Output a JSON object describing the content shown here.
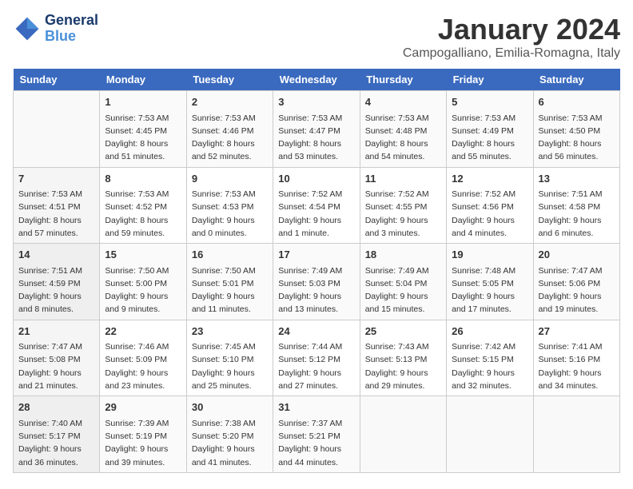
{
  "header": {
    "logo_line1": "General",
    "logo_line2": "Blue",
    "title": "January 2024",
    "subtitle": "Campogalliano, Emilia-Romagna, Italy"
  },
  "days_of_week": [
    "Sunday",
    "Monday",
    "Tuesday",
    "Wednesday",
    "Thursday",
    "Friday",
    "Saturday"
  ],
  "weeks": [
    [
      {
        "day": "",
        "sunrise": "",
        "sunset": "",
        "daylight": ""
      },
      {
        "day": "1",
        "sunrise": "Sunrise: 7:53 AM",
        "sunset": "Sunset: 4:45 PM",
        "daylight": "Daylight: 8 hours and 51 minutes."
      },
      {
        "day": "2",
        "sunrise": "Sunrise: 7:53 AM",
        "sunset": "Sunset: 4:46 PM",
        "daylight": "Daylight: 8 hours and 52 minutes."
      },
      {
        "day": "3",
        "sunrise": "Sunrise: 7:53 AM",
        "sunset": "Sunset: 4:47 PM",
        "daylight": "Daylight: 8 hours and 53 minutes."
      },
      {
        "day": "4",
        "sunrise": "Sunrise: 7:53 AM",
        "sunset": "Sunset: 4:48 PM",
        "daylight": "Daylight: 8 hours and 54 minutes."
      },
      {
        "day": "5",
        "sunrise": "Sunrise: 7:53 AM",
        "sunset": "Sunset: 4:49 PM",
        "daylight": "Daylight: 8 hours and 55 minutes."
      },
      {
        "day": "6",
        "sunrise": "Sunrise: 7:53 AM",
        "sunset": "Sunset: 4:50 PM",
        "daylight": "Daylight: 8 hours and 56 minutes."
      }
    ],
    [
      {
        "day": "7",
        "sunrise": "Sunrise: 7:53 AM",
        "sunset": "Sunset: 4:51 PM",
        "daylight": "Daylight: 8 hours and 57 minutes."
      },
      {
        "day": "8",
        "sunrise": "Sunrise: 7:53 AM",
        "sunset": "Sunset: 4:52 PM",
        "daylight": "Daylight: 8 hours and 59 minutes."
      },
      {
        "day": "9",
        "sunrise": "Sunrise: 7:53 AM",
        "sunset": "Sunset: 4:53 PM",
        "daylight": "Daylight: 9 hours and 0 minutes."
      },
      {
        "day": "10",
        "sunrise": "Sunrise: 7:52 AM",
        "sunset": "Sunset: 4:54 PM",
        "daylight": "Daylight: 9 hours and 1 minute."
      },
      {
        "day": "11",
        "sunrise": "Sunrise: 7:52 AM",
        "sunset": "Sunset: 4:55 PM",
        "daylight": "Daylight: 9 hours and 3 minutes."
      },
      {
        "day": "12",
        "sunrise": "Sunrise: 7:52 AM",
        "sunset": "Sunset: 4:56 PM",
        "daylight": "Daylight: 9 hours and 4 minutes."
      },
      {
        "day": "13",
        "sunrise": "Sunrise: 7:51 AM",
        "sunset": "Sunset: 4:58 PM",
        "daylight": "Daylight: 9 hours and 6 minutes."
      }
    ],
    [
      {
        "day": "14",
        "sunrise": "Sunrise: 7:51 AM",
        "sunset": "Sunset: 4:59 PM",
        "daylight": "Daylight: 9 hours and 8 minutes."
      },
      {
        "day": "15",
        "sunrise": "Sunrise: 7:50 AM",
        "sunset": "Sunset: 5:00 PM",
        "daylight": "Daylight: 9 hours and 9 minutes."
      },
      {
        "day": "16",
        "sunrise": "Sunrise: 7:50 AM",
        "sunset": "Sunset: 5:01 PM",
        "daylight": "Daylight: 9 hours and 11 minutes."
      },
      {
        "day": "17",
        "sunrise": "Sunrise: 7:49 AM",
        "sunset": "Sunset: 5:03 PM",
        "daylight": "Daylight: 9 hours and 13 minutes."
      },
      {
        "day": "18",
        "sunrise": "Sunrise: 7:49 AM",
        "sunset": "Sunset: 5:04 PM",
        "daylight": "Daylight: 9 hours and 15 minutes."
      },
      {
        "day": "19",
        "sunrise": "Sunrise: 7:48 AM",
        "sunset": "Sunset: 5:05 PM",
        "daylight": "Daylight: 9 hours and 17 minutes."
      },
      {
        "day": "20",
        "sunrise": "Sunrise: 7:47 AM",
        "sunset": "Sunset: 5:06 PM",
        "daylight": "Daylight: 9 hours and 19 minutes."
      }
    ],
    [
      {
        "day": "21",
        "sunrise": "Sunrise: 7:47 AM",
        "sunset": "Sunset: 5:08 PM",
        "daylight": "Daylight: 9 hours and 21 minutes."
      },
      {
        "day": "22",
        "sunrise": "Sunrise: 7:46 AM",
        "sunset": "Sunset: 5:09 PM",
        "daylight": "Daylight: 9 hours and 23 minutes."
      },
      {
        "day": "23",
        "sunrise": "Sunrise: 7:45 AM",
        "sunset": "Sunset: 5:10 PM",
        "daylight": "Daylight: 9 hours and 25 minutes."
      },
      {
        "day": "24",
        "sunrise": "Sunrise: 7:44 AM",
        "sunset": "Sunset: 5:12 PM",
        "daylight": "Daylight: 9 hours and 27 minutes."
      },
      {
        "day": "25",
        "sunrise": "Sunrise: 7:43 AM",
        "sunset": "Sunset: 5:13 PM",
        "daylight": "Daylight: 9 hours and 29 minutes."
      },
      {
        "day": "26",
        "sunrise": "Sunrise: 7:42 AM",
        "sunset": "Sunset: 5:15 PM",
        "daylight": "Daylight: 9 hours and 32 minutes."
      },
      {
        "day": "27",
        "sunrise": "Sunrise: 7:41 AM",
        "sunset": "Sunset: 5:16 PM",
        "daylight": "Daylight: 9 hours and 34 minutes."
      }
    ],
    [
      {
        "day": "28",
        "sunrise": "Sunrise: 7:40 AM",
        "sunset": "Sunset: 5:17 PM",
        "daylight": "Daylight: 9 hours and 36 minutes."
      },
      {
        "day": "29",
        "sunrise": "Sunrise: 7:39 AM",
        "sunset": "Sunset: 5:19 PM",
        "daylight": "Daylight: 9 hours and 39 minutes."
      },
      {
        "day": "30",
        "sunrise": "Sunrise: 7:38 AM",
        "sunset": "Sunset: 5:20 PM",
        "daylight": "Daylight: 9 hours and 41 minutes."
      },
      {
        "day": "31",
        "sunrise": "Sunrise: 7:37 AM",
        "sunset": "Sunset: 5:21 PM",
        "daylight": "Daylight: 9 hours and 44 minutes."
      },
      {
        "day": "",
        "sunrise": "",
        "sunset": "",
        "daylight": ""
      },
      {
        "day": "",
        "sunrise": "",
        "sunset": "",
        "daylight": ""
      },
      {
        "day": "",
        "sunrise": "",
        "sunset": "",
        "daylight": ""
      }
    ]
  ]
}
